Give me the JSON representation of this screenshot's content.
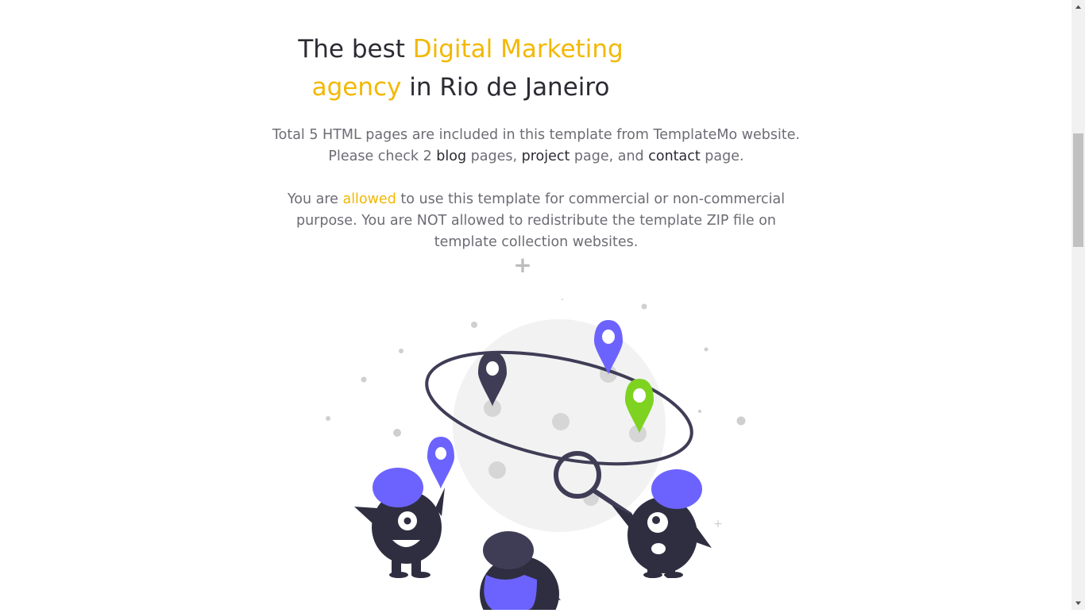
{
  "hero": {
    "title_part1": "The best ",
    "title_accent1": "Digital Marketing",
    "title_accent2": "agency",
    "title_part2": " in Rio de Janeiro",
    "para1_a": "Total 5 HTML pages are included in this template from TemplateMo website.",
    "para1_b": "Please check 2 ",
    "para1_blog": "blog",
    "para1_c": " pages, ",
    "para1_project": "project",
    "para1_d": " page, and ",
    "para1_contact": "contact",
    "para1_e": " page.",
    "para2_a": "You are ",
    "para2_allowed": "allowed",
    "para2_b": " to use this template for commercial or non-commercial purpose. You are NOT allowed to redistribute the template ZIP file on template collection websites.",
    "plus_sign": "+"
  },
  "illustration": {
    "icon": "world-map-pins-illustration"
  },
  "colors": {
    "accent": "#f2b800",
    "heading": "#2c2b33",
    "text": "#6c6c74",
    "purple": "#6c63ff",
    "green": "#7ed321",
    "dark": "#2f2e41",
    "globe": "#f2f2f2"
  },
  "scrollbar": {
    "up_icon": "arrow-up-icon",
    "down_icon": "arrow-down-icon"
  }
}
